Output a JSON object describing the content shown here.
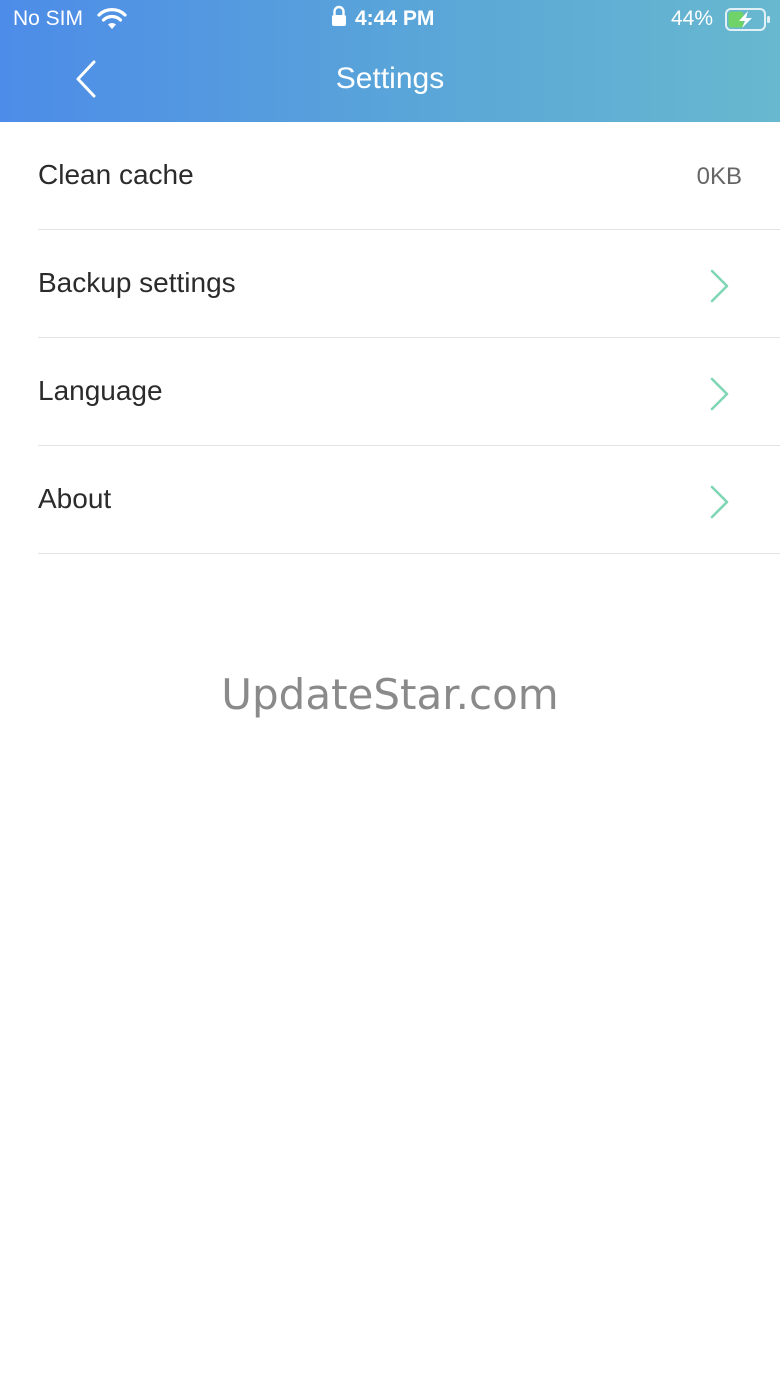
{
  "status_bar": {
    "carrier": "No SIM",
    "time": "4:44 PM",
    "battery_percent": "44%",
    "battery_level": 0.44,
    "wifi_icon": "wifi-icon",
    "lock_icon": "lock-icon",
    "battery_icon": "battery-charging-icon"
  },
  "nav": {
    "title": "Settings",
    "back_icon": "chevron-left-icon"
  },
  "settings": {
    "items": [
      {
        "label": "Clean cache",
        "value": "0KB"
      },
      {
        "label": "Backup settings",
        "icon": "chevron-right-icon"
      },
      {
        "label": "Language",
        "icon": "chevron-right-icon"
      },
      {
        "label": "About",
        "icon": "chevron-right-icon"
      }
    ]
  },
  "watermark": "UpdateStar.com",
  "colors": {
    "header_gradient_start": "#4d8ce8",
    "header_gradient_end": "#68b8cf",
    "chevron": "#7fd6b4",
    "battery_fill": "#6fd36a"
  }
}
